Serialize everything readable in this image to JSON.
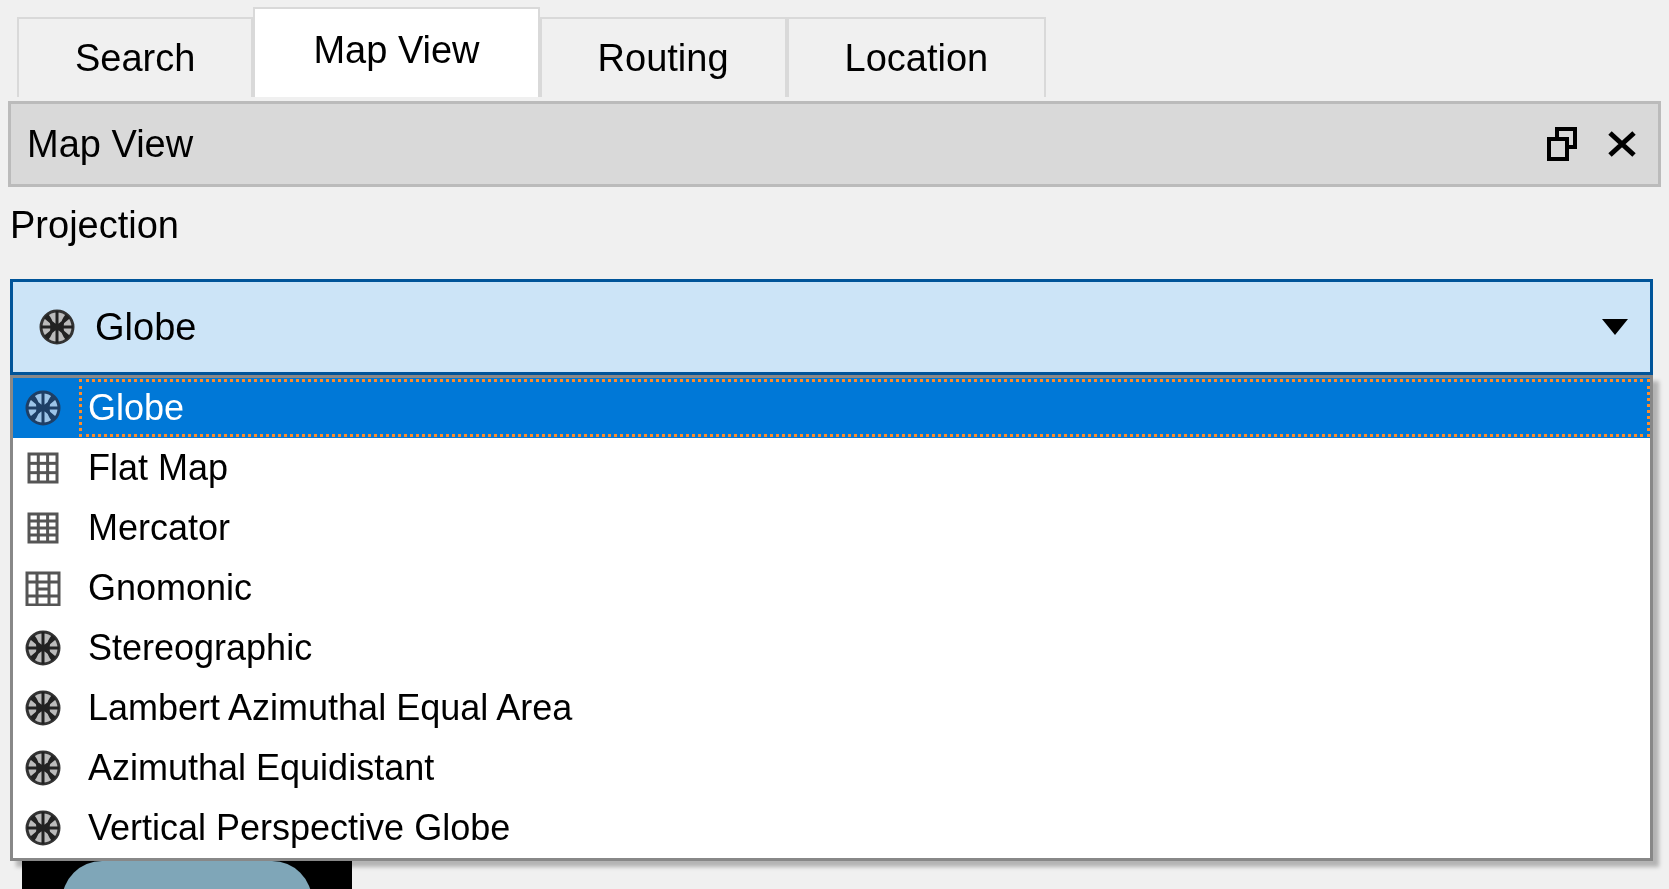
{
  "tabs": [
    {
      "label": "Search",
      "selected": false
    },
    {
      "label": "Map View",
      "selected": true
    },
    {
      "label": "Routing",
      "selected": false
    },
    {
      "label": "Location",
      "selected": false
    }
  ],
  "dock": {
    "title": "Map View"
  },
  "projection": {
    "label": "Projection",
    "value": "Globe",
    "kind": "globe"
  },
  "options": [
    {
      "label": "Globe",
      "kind": "globe",
      "selected": true
    },
    {
      "label": "Flat Map",
      "kind": "grid",
      "selected": false
    },
    {
      "label": "Mercator",
      "kind": "grid-fine",
      "selected": false
    },
    {
      "label": "Gnomonic",
      "kind": "gnomonic",
      "selected": false
    },
    {
      "label": "Stereographic",
      "kind": "globe",
      "selected": false
    },
    {
      "label": "Lambert Azimuthal Equal Area",
      "kind": "globe",
      "selected": false
    },
    {
      "label": "Azimuthal Equidistant",
      "kind": "globe",
      "selected": false
    },
    {
      "label": "Vertical Perspective Globe",
      "kind": "globe",
      "selected": false
    }
  ]
}
